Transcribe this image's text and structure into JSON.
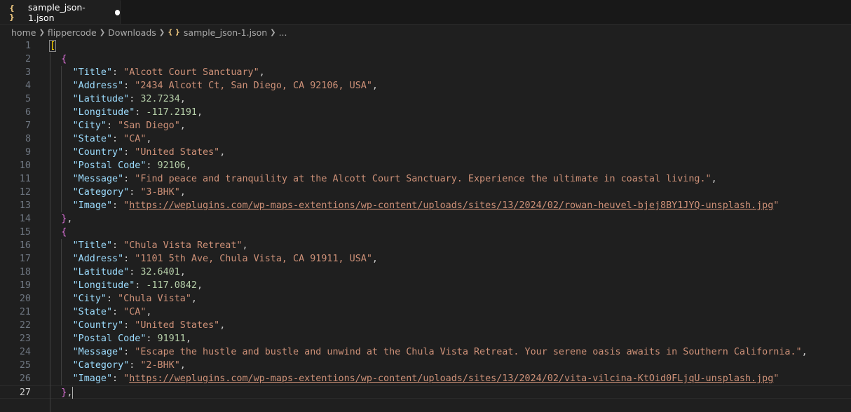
{
  "tab": {
    "icon": "{ }",
    "label": "sample_json-1.json"
  },
  "breadcrumb": [
    "home",
    "flippercode",
    "Downloads",
    "sample_json-1.json",
    "..."
  ],
  "lines": [
    {
      "n": "1",
      "indent": 0,
      "tokens": [
        {
          "t": "bracket1",
          "v": "["
        }
      ]
    },
    {
      "n": "2",
      "indent": 1,
      "tokens": [
        {
          "t": "bracket2",
          "v": "{"
        }
      ]
    },
    {
      "n": "3",
      "indent": 2,
      "tokens": [
        {
          "t": "key",
          "v": "\"Title\""
        },
        {
          "t": "punc",
          "v": ": "
        },
        {
          "t": "str",
          "v": "\"Alcott Court Sanctuary\""
        },
        {
          "t": "punc",
          "v": ","
        }
      ]
    },
    {
      "n": "4",
      "indent": 2,
      "tokens": [
        {
          "t": "key",
          "v": "\"Address\""
        },
        {
          "t": "punc",
          "v": ": "
        },
        {
          "t": "str",
          "v": "\"2434 Alcott Ct, San Diego, CA 92106, USA\""
        },
        {
          "t": "punc",
          "v": ","
        }
      ]
    },
    {
      "n": "5",
      "indent": 2,
      "tokens": [
        {
          "t": "key",
          "v": "\"Latitude\""
        },
        {
          "t": "punc",
          "v": ": "
        },
        {
          "t": "num",
          "v": "32.7234"
        },
        {
          "t": "punc",
          "v": ","
        }
      ]
    },
    {
      "n": "6",
      "indent": 2,
      "tokens": [
        {
          "t": "key",
          "v": "\"Longitude\""
        },
        {
          "t": "punc",
          "v": ": "
        },
        {
          "t": "num",
          "v": "-117.2191"
        },
        {
          "t": "punc",
          "v": ","
        }
      ]
    },
    {
      "n": "7",
      "indent": 2,
      "tokens": [
        {
          "t": "key",
          "v": "\"City\""
        },
        {
          "t": "punc",
          "v": ": "
        },
        {
          "t": "str",
          "v": "\"San Diego\""
        },
        {
          "t": "punc",
          "v": ","
        }
      ]
    },
    {
      "n": "8",
      "indent": 2,
      "tokens": [
        {
          "t": "key",
          "v": "\"State\""
        },
        {
          "t": "punc",
          "v": ": "
        },
        {
          "t": "str",
          "v": "\"CA\""
        },
        {
          "t": "punc",
          "v": ","
        }
      ]
    },
    {
      "n": "9",
      "indent": 2,
      "tokens": [
        {
          "t": "key",
          "v": "\"Country\""
        },
        {
          "t": "punc",
          "v": ": "
        },
        {
          "t": "str",
          "v": "\"United States\""
        },
        {
          "t": "punc",
          "v": ","
        }
      ]
    },
    {
      "n": "10",
      "indent": 2,
      "tokens": [
        {
          "t": "key",
          "v": "\"Postal Code\""
        },
        {
          "t": "punc",
          "v": ": "
        },
        {
          "t": "num",
          "v": "92106"
        },
        {
          "t": "punc",
          "v": ","
        }
      ]
    },
    {
      "n": "11",
      "indent": 2,
      "tokens": [
        {
          "t": "key",
          "v": "\"Message\""
        },
        {
          "t": "punc",
          "v": ": "
        },
        {
          "t": "str",
          "v": "\"Find peace and tranquility at the Alcott Court Sanctuary. Experience the ultimate in coastal living.\""
        },
        {
          "t": "punc",
          "v": ","
        }
      ]
    },
    {
      "n": "12",
      "indent": 2,
      "tokens": [
        {
          "t": "key",
          "v": "\"Category\""
        },
        {
          "t": "punc",
          "v": ": "
        },
        {
          "t": "str",
          "v": "\"3-BHK\""
        },
        {
          "t": "punc",
          "v": ","
        }
      ]
    },
    {
      "n": "13",
      "indent": 2,
      "tokens": [
        {
          "t": "key",
          "v": "\"Image\""
        },
        {
          "t": "punc",
          "v": ": "
        },
        {
          "t": "str",
          "v": "\""
        },
        {
          "t": "url",
          "v": "https://weplugins.com/wp-maps-extentions/wp-content/uploads/sites/13/2024/02/rowan-heuvel-bjej8BY1JYQ-unsplash.jpg"
        },
        {
          "t": "str",
          "v": "\""
        }
      ]
    },
    {
      "n": "14",
      "indent": 1,
      "tokens": [
        {
          "t": "bracket2",
          "v": "}"
        },
        {
          "t": "punc",
          "v": ","
        }
      ]
    },
    {
      "n": "15",
      "indent": 1,
      "tokens": [
        {
          "t": "bracket2",
          "v": "{"
        }
      ]
    },
    {
      "n": "16",
      "indent": 2,
      "tokens": [
        {
          "t": "key",
          "v": "\"Title\""
        },
        {
          "t": "punc",
          "v": ": "
        },
        {
          "t": "str",
          "v": "\"Chula Vista Retreat\""
        },
        {
          "t": "punc",
          "v": ","
        }
      ]
    },
    {
      "n": "17",
      "indent": 2,
      "tokens": [
        {
          "t": "key",
          "v": "\"Address\""
        },
        {
          "t": "punc",
          "v": ": "
        },
        {
          "t": "str",
          "v": "\"1101 5th Ave, Chula Vista, CA 91911, USA\""
        },
        {
          "t": "punc",
          "v": ","
        }
      ]
    },
    {
      "n": "18",
      "indent": 2,
      "tokens": [
        {
          "t": "key",
          "v": "\"Latitude\""
        },
        {
          "t": "punc",
          "v": ": "
        },
        {
          "t": "num",
          "v": "32.6401"
        },
        {
          "t": "punc",
          "v": ","
        }
      ]
    },
    {
      "n": "19",
      "indent": 2,
      "tokens": [
        {
          "t": "key",
          "v": "\"Longitude\""
        },
        {
          "t": "punc",
          "v": ": "
        },
        {
          "t": "num",
          "v": "-117.0842"
        },
        {
          "t": "punc",
          "v": ","
        }
      ]
    },
    {
      "n": "20",
      "indent": 2,
      "tokens": [
        {
          "t": "key",
          "v": "\"City\""
        },
        {
          "t": "punc",
          "v": ": "
        },
        {
          "t": "str",
          "v": "\"Chula Vista\""
        },
        {
          "t": "punc",
          "v": ","
        }
      ]
    },
    {
      "n": "21",
      "indent": 2,
      "tokens": [
        {
          "t": "key",
          "v": "\"State\""
        },
        {
          "t": "punc",
          "v": ": "
        },
        {
          "t": "str",
          "v": "\"CA\""
        },
        {
          "t": "punc",
          "v": ","
        }
      ]
    },
    {
      "n": "22",
      "indent": 2,
      "tokens": [
        {
          "t": "key",
          "v": "\"Country\""
        },
        {
          "t": "punc",
          "v": ": "
        },
        {
          "t": "str",
          "v": "\"United States\""
        },
        {
          "t": "punc",
          "v": ","
        }
      ]
    },
    {
      "n": "23",
      "indent": 2,
      "tokens": [
        {
          "t": "key",
          "v": "\"Postal Code\""
        },
        {
          "t": "punc",
          "v": ": "
        },
        {
          "t": "num",
          "v": "91911"
        },
        {
          "t": "punc",
          "v": ","
        }
      ]
    },
    {
      "n": "24",
      "indent": 2,
      "tokens": [
        {
          "t": "key",
          "v": "\"Message\""
        },
        {
          "t": "punc",
          "v": ": "
        },
        {
          "t": "str",
          "v": "\"Escape the hustle and bustle and unwind at the Chula Vista Retreat. Your serene oasis awaits in Southern California.\""
        },
        {
          "t": "punc",
          "v": ","
        }
      ]
    },
    {
      "n": "25",
      "indent": 2,
      "tokens": [
        {
          "t": "key",
          "v": "\"Category\""
        },
        {
          "t": "punc",
          "v": ": "
        },
        {
          "t": "str",
          "v": "\"2-BHK\""
        },
        {
          "t": "punc",
          "v": ","
        }
      ]
    },
    {
      "n": "26",
      "indent": 2,
      "tokens": [
        {
          "t": "key",
          "v": "\"Image\""
        },
        {
          "t": "punc",
          "v": ": "
        },
        {
          "t": "str",
          "v": "\""
        },
        {
          "t": "url",
          "v": "https://weplugins.com/wp-maps-extentions/wp-content/uploads/sites/13/2024/02/vita-vilcina-KtOid0FLjqU-unsplash.jpg"
        },
        {
          "t": "str",
          "v": "\""
        }
      ]
    },
    {
      "n": "27",
      "indent": 1,
      "current": true,
      "tokens": [
        {
          "t": "bracket2",
          "v": "}"
        },
        {
          "t": "punc",
          "v": ","
        }
      ]
    }
  ],
  "colors": {
    "background": "#1f1f1f",
    "key": "#9cdcfe",
    "string": "#ce9178",
    "number": "#b5cea8",
    "bracket_outer": "#ffd700",
    "bracket_inner": "#da70d6"
  }
}
